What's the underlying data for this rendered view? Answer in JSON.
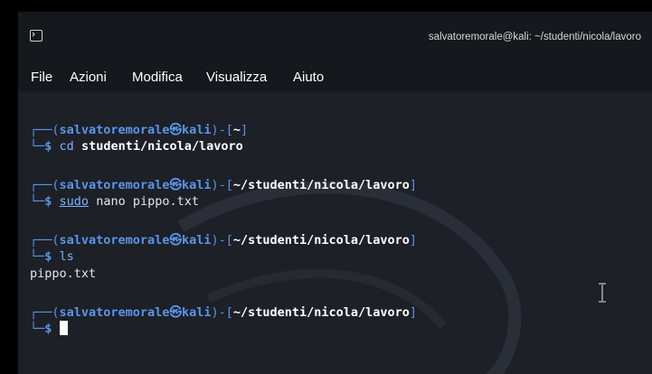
{
  "window": {
    "title": "salvatoremorale@kali: ~/studenti/nicola/lavoro"
  },
  "menu": {
    "items": [
      "File",
      "Azioni",
      "Modifica",
      "Visualizza",
      "Aiuto"
    ]
  },
  "terminal": {
    "prompts": [
      {
        "open": "┌──(",
        "user": "salvatoremorale",
        "at": "㉿",
        "host": "kali",
        "mid": ")-[",
        "path": "~",
        "close": "]",
        "arrow": "└─",
        "dollar": "$",
        "command": "cd",
        "args": " studenti/nicola/lavoro"
      },
      {
        "open": "┌──(",
        "user": "salvatoremorale",
        "at": "㉿",
        "host": "kali",
        "mid": ")-[",
        "path": "~/studenti/nicola/lavoro",
        "close": "]",
        "arrow": "└─",
        "dollar": "$",
        "command": "sudo",
        "args": " nano pippo.txt"
      },
      {
        "open": "┌──(",
        "user": "salvatoremorale",
        "at": "㉿",
        "host": "kali",
        "mid": ")-[",
        "path": "~/studenti/nicola/lavoro",
        "close": "]",
        "arrow": "└─",
        "dollar": "$",
        "command": "ls",
        "args": ""
      },
      {
        "open": "┌──(",
        "user": "salvatoremorale",
        "at": "㉿",
        "host": "kali",
        "mid": ")-[",
        "path": "~/studenti/nicola/lavoro",
        "close": "]",
        "arrow": "└─",
        "dollar": "$",
        "command": "",
        "args": ""
      }
    ],
    "output_ls": "pippo.txt"
  },
  "colors": {
    "prompt_blue": "#5a95e8",
    "background": "#1d2027",
    "titlebar": "#15181c"
  }
}
